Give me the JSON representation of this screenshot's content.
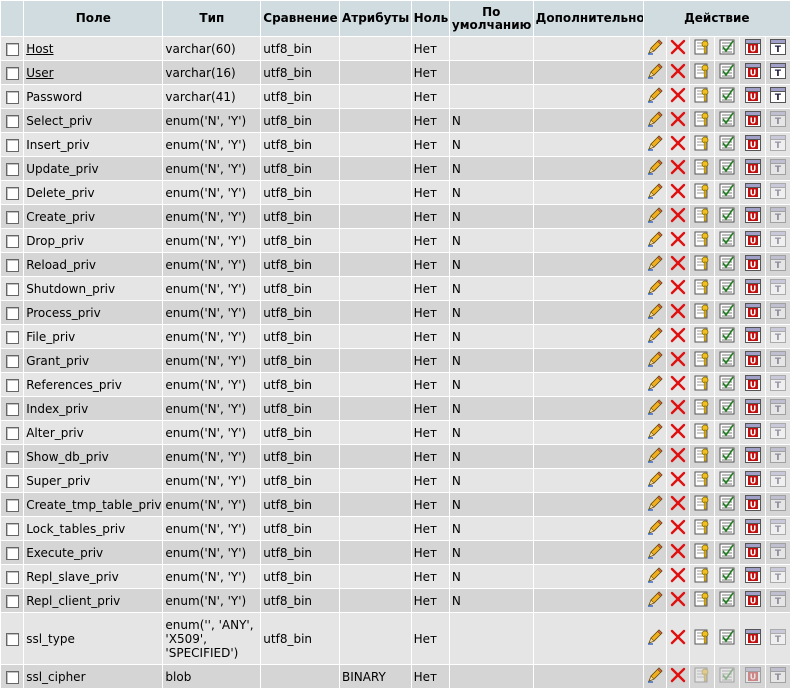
{
  "header": {
    "field": "Поле",
    "type": "Тип",
    "collation": "Сравнение",
    "attributes": "Атрибуты",
    "null": "Ноль",
    "default_line1": "По",
    "default_line2": "умолчанию",
    "extra": "Дополнительно",
    "action": "Действие"
  },
  "icons": [
    "edit-pencil-icon",
    "drop-x-icon",
    "primary-key-icon",
    "index-icon",
    "unique-icon",
    "fulltext-icon"
  ],
  "colors": {
    "header_bg": "#d0dce0",
    "row_odd": "#e5e5e5",
    "row_even": "#d5d5d5",
    "drop_red": "#e01010"
  },
  "rows": [
    {
      "field": "Host",
      "type": "varchar(60)",
      "collation": "utf8_bin",
      "attributes": "",
      "null": "Нет",
      "default": "",
      "extra": "",
      "primary": true,
      "link": true,
      "dim": [
        false,
        false,
        false,
        false,
        false,
        false
      ]
    },
    {
      "field": "User",
      "type": "varchar(16)",
      "collation": "utf8_bin",
      "attributes": "",
      "null": "Нет",
      "default": "",
      "extra": "",
      "primary": true,
      "link": true,
      "dim": [
        false,
        false,
        false,
        false,
        false,
        false
      ]
    },
    {
      "field": "Password",
      "type": "varchar(41)",
      "collation": "utf8_bin",
      "attributes": "",
      "null": "Нет",
      "default": "",
      "extra": "",
      "primary": false,
      "link": false,
      "dim": [
        false,
        false,
        false,
        false,
        false,
        false
      ]
    },
    {
      "field": "Select_priv",
      "type": "enum('N', 'Y')",
      "collation": "utf8_bin",
      "attributes": "",
      "null": "Нет",
      "default": "N",
      "extra": "",
      "primary": false,
      "link": false,
      "dim": [
        false,
        false,
        false,
        false,
        false,
        true
      ]
    },
    {
      "field": "Insert_priv",
      "type": "enum('N', 'Y')",
      "collation": "utf8_bin",
      "attributes": "",
      "null": "Нет",
      "default": "N",
      "extra": "",
      "primary": false,
      "link": false,
      "dim": [
        false,
        false,
        false,
        false,
        false,
        true
      ]
    },
    {
      "field": "Update_priv",
      "type": "enum('N', 'Y')",
      "collation": "utf8_bin",
      "attributes": "",
      "null": "Нет",
      "default": "N",
      "extra": "",
      "primary": false,
      "link": false,
      "dim": [
        false,
        false,
        false,
        false,
        false,
        true
      ]
    },
    {
      "field": "Delete_priv",
      "type": "enum('N', 'Y')",
      "collation": "utf8_bin",
      "attributes": "",
      "null": "Нет",
      "default": "N",
      "extra": "",
      "primary": false,
      "link": false,
      "dim": [
        false,
        false,
        false,
        false,
        false,
        true
      ]
    },
    {
      "field": "Create_priv",
      "type": "enum('N', 'Y')",
      "collation": "utf8_bin",
      "attributes": "",
      "null": "Нет",
      "default": "N",
      "extra": "",
      "primary": false,
      "link": false,
      "dim": [
        false,
        false,
        false,
        false,
        false,
        true
      ]
    },
    {
      "field": "Drop_priv",
      "type": "enum('N', 'Y')",
      "collation": "utf8_bin",
      "attributes": "",
      "null": "Нет",
      "default": "N",
      "extra": "",
      "primary": false,
      "link": false,
      "dim": [
        false,
        false,
        false,
        false,
        false,
        true
      ]
    },
    {
      "field": "Reload_priv",
      "type": "enum('N', 'Y')",
      "collation": "utf8_bin",
      "attributes": "",
      "null": "Нет",
      "default": "N",
      "extra": "",
      "primary": false,
      "link": false,
      "dim": [
        false,
        false,
        false,
        false,
        false,
        true
      ]
    },
    {
      "field": "Shutdown_priv",
      "type": "enum('N', 'Y')",
      "collation": "utf8_bin",
      "attributes": "",
      "null": "Нет",
      "default": "N",
      "extra": "",
      "primary": false,
      "link": false,
      "dim": [
        false,
        false,
        false,
        false,
        false,
        true
      ]
    },
    {
      "field": "Process_priv",
      "type": "enum('N', 'Y')",
      "collation": "utf8_bin",
      "attributes": "",
      "null": "Нет",
      "default": "N",
      "extra": "",
      "primary": false,
      "link": false,
      "dim": [
        false,
        false,
        false,
        false,
        false,
        true
      ]
    },
    {
      "field": "File_priv",
      "type": "enum('N', 'Y')",
      "collation": "utf8_bin",
      "attributes": "",
      "null": "Нет",
      "default": "N",
      "extra": "",
      "primary": false,
      "link": false,
      "dim": [
        false,
        false,
        false,
        false,
        false,
        true
      ]
    },
    {
      "field": "Grant_priv",
      "type": "enum('N', 'Y')",
      "collation": "utf8_bin",
      "attributes": "",
      "null": "Нет",
      "default": "N",
      "extra": "",
      "primary": false,
      "link": false,
      "dim": [
        false,
        false,
        false,
        false,
        false,
        true
      ]
    },
    {
      "field": "References_priv",
      "type": "enum('N', 'Y')",
      "collation": "utf8_bin",
      "attributes": "",
      "null": "Нет",
      "default": "N",
      "extra": "",
      "primary": false,
      "link": false,
      "dim": [
        false,
        false,
        false,
        false,
        false,
        true
      ]
    },
    {
      "field": "Index_priv",
      "type": "enum('N', 'Y')",
      "collation": "utf8_bin",
      "attributes": "",
      "null": "Нет",
      "default": "N",
      "extra": "",
      "primary": false,
      "link": false,
      "dim": [
        false,
        false,
        false,
        false,
        false,
        true
      ]
    },
    {
      "field": "Alter_priv",
      "type": "enum('N', 'Y')",
      "collation": "utf8_bin",
      "attributes": "",
      "null": "Нет",
      "default": "N",
      "extra": "",
      "primary": false,
      "link": false,
      "dim": [
        false,
        false,
        false,
        false,
        false,
        true
      ]
    },
    {
      "field": "Show_db_priv",
      "type": "enum('N', 'Y')",
      "collation": "utf8_bin",
      "attributes": "",
      "null": "Нет",
      "default": "N",
      "extra": "",
      "primary": false,
      "link": false,
      "dim": [
        false,
        false,
        false,
        false,
        false,
        true
      ]
    },
    {
      "field": "Super_priv",
      "type": "enum('N', 'Y')",
      "collation": "utf8_bin",
      "attributes": "",
      "null": "Нет",
      "default": "N",
      "extra": "",
      "primary": false,
      "link": false,
      "dim": [
        false,
        false,
        false,
        false,
        false,
        true
      ]
    },
    {
      "field": "Create_tmp_table_priv",
      "type": "enum('N', 'Y')",
      "collation": "utf8_bin",
      "attributes": "",
      "null": "Нет",
      "default": "N",
      "extra": "",
      "primary": false,
      "link": false,
      "dim": [
        false,
        false,
        false,
        false,
        false,
        true
      ]
    },
    {
      "field": "Lock_tables_priv",
      "type": "enum('N', 'Y')",
      "collation": "utf8_bin",
      "attributes": "",
      "null": "Нет",
      "default": "N",
      "extra": "",
      "primary": false,
      "link": false,
      "dim": [
        false,
        false,
        false,
        false,
        false,
        true
      ]
    },
    {
      "field": "Execute_priv",
      "type": "enum('N', 'Y')",
      "collation": "utf8_bin",
      "attributes": "",
      "null": "Нет",
      "default": "N",
      "extra": "",
      "primary": false,
      "link": false,
      "dim": [
        false,
        false,
        false,
        false,
        false,
        true
      ]
    },
    {
      "field": "Repl_slave_priv",
      "type": "enum('N', 'Y')",
      "collation": "utf8_bin",
      "attributes": "",
      "null": "Нет",
      "default": "N",
      "extra": "",
      "primary": false,
      "link": false,
      "dim": [
        false,
        false,
        false,
        false,
        false,
        true
      ]
    },
    {
      "field": "Repl_client_priv",
      "type": "enum('N', 'Y')",
      "collation": "utf8_bin",
      "attributes": "",
      "null": "Нет",
      "default": "N",
      "extra": "",
      "primary": false,
      "link": false,
      "dim": [
        false,
        false,
        false,
        false,
        false,
        true
      ]
    },
    {
      "field": "ssl_type",
      "type": "enum('', 'ANY', 'X509', 'SPECIFIED')",
      "collation": "utf8_bin",
      "attributes": "",
      "null": "Нет",
      "default": "",
      "extra": "",
      "primary": false,
      "link": false,
      "dim": [
        false,
        false,
        false,
        false,
        false,
        true
      ]
    },
    {
      "field": "ssl_cipher",
      "type": "blob",
      "collation": "",
      "attributes": "BINARY",
      "null": "Нет",
      "default": "",
      "extra": "",
      "primary": false,
      "link": false,
      "dim": [
        false,
        false,
        true,
        true,
        true,
        true
      ]
    }
  ]
}
